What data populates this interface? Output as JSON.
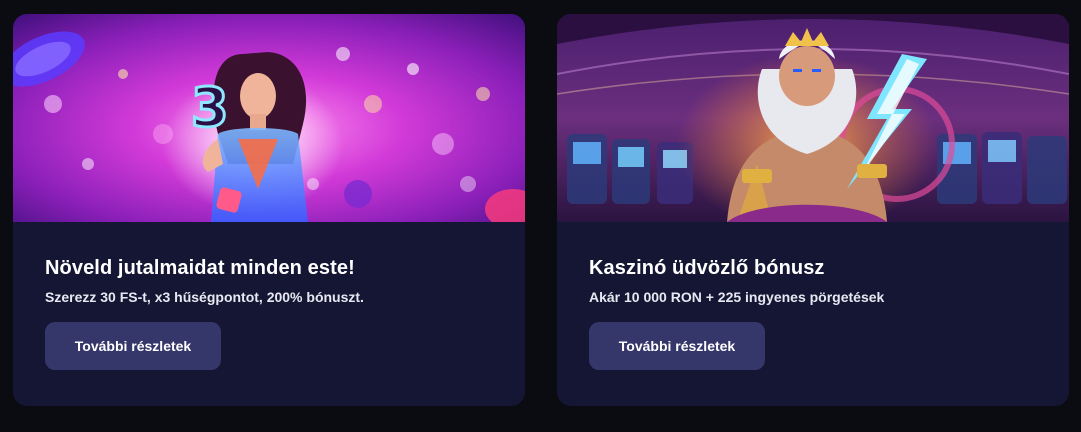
{
  "promos": [
    {
      "title": "Növeld jutalmaidat minden este!",
      "description": "Szerezz 30 FS-t, x3 hűségpontot, 200% bónuszt.",
      "button_label": "További részletek",
      "banner_number": "3"
    },
    {
      "title": "Kaszinó üdvözlő bónusz",
      "description": "Akár 10 000 RON + 225 ingyenes pörgetések",
      "button_label": "További részletek"
    }
  ],
  "colors": {
    "page_bg": "#0b0b12",
    "card_bg": "#151633",
    "button_bg": "#35376a",
    "text": "#ffffff"
  }
}
